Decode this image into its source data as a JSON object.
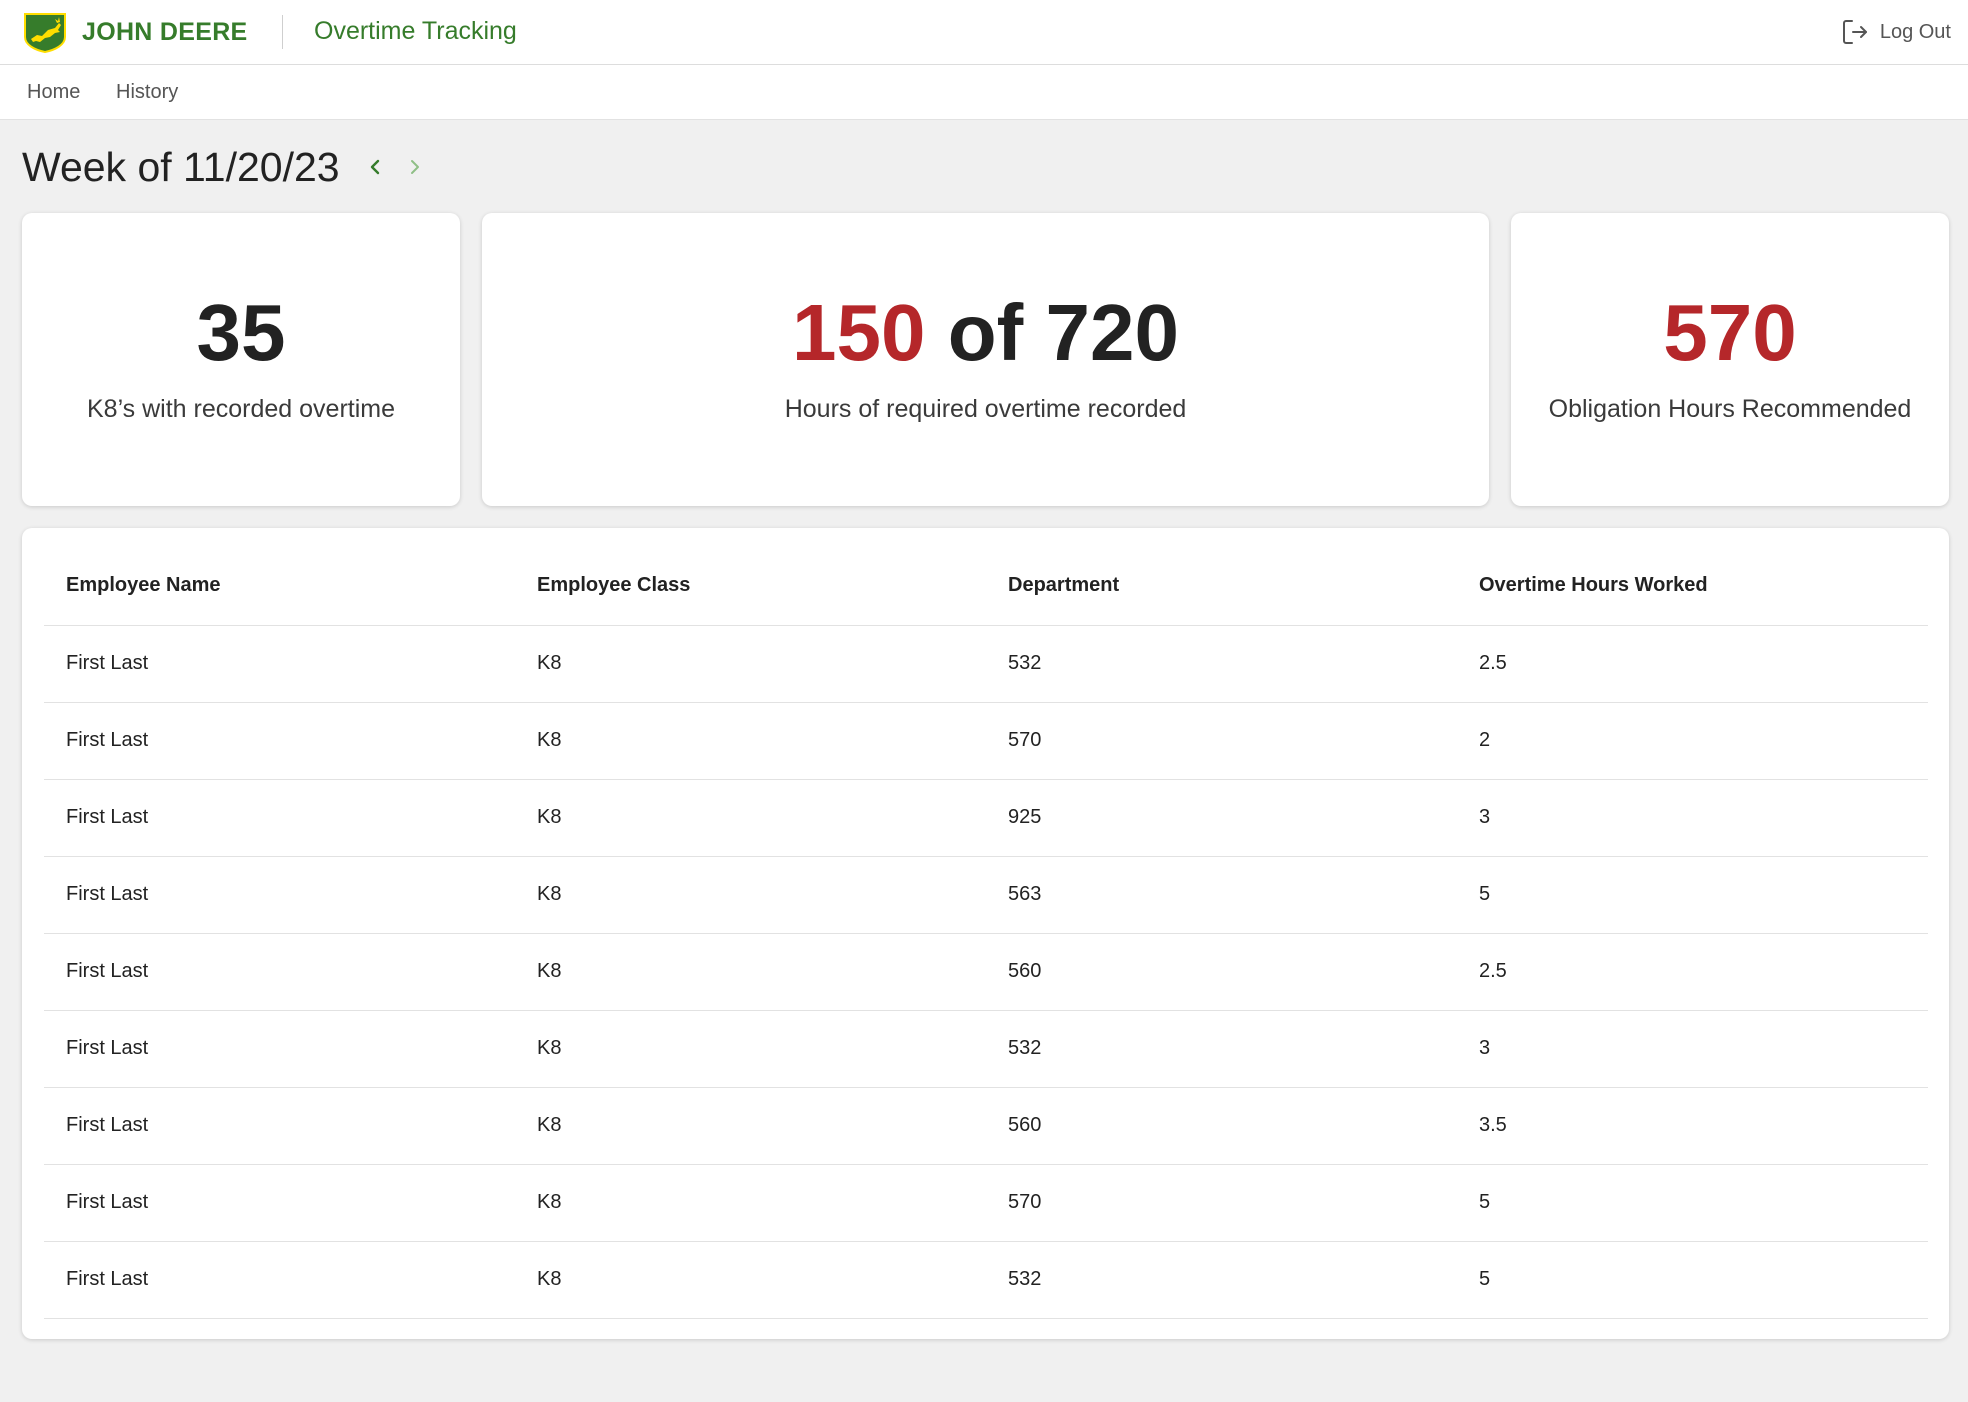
{
  "header": {
    "brand": "JOHN DEERE",
    "app_title": "Overtime Tracking",
    "logout_label": "Log Out"
  },
  "nav": {
    "items": [
      {
        "label": "Home"
      },
      {
        "label": "History"
      }
    ]
  },
  "week": {
    "title": "Week of 11/20/23",
    "prev_icon": "chevron-left-icon",
    "next_icon": "chevron-right-icon"
  },
  "stats": {
    "k8_count": {
      "value": "35",
      "label": "K8’s with recorded overtime"
    },
    "required_hours": {
      "recorded": "150",
      "of_text": "of",
      "total": "720",
      "label": "Hours of required overtime recorded"
    },
    "obligation": {
      "value": "570",
      "label": "Obligation Hours Recommended"
    }
  },
  "table": {
    "headers": [
      "Employee Name",
      "Employee Class",
      "Department",
      "Overtime Hours Worked"
    ],
    "rows": [
      [
        "First Last",
        "K8",
        "532",
        "2.5"
      ],
      [
        "First Last",
        "K8",
        "570",
        "2"
      ],
      [
        "First Last",
        "K8",
        "925",
        "3"
      ],
      [
        "First Last",
        "K8",
        "563",
        "5"
      ],
      [
        "First Last",
        "K8",
        "560",
        "2.5"
      ],
      [
        "First Last",
        "K8",
        "532",
        "3"
      ],
      [
        "First Last",
        "K8",
        "560",
        "3.5"
      ],
      [
        "First Last",
        "K8",
        "570",
        "5"
      ],
      [
        "First Last",
        "K8",
        "532",
        "5"
      ]
    ]
  },
  "colors": {
    "brand_green": "#367c2b",
    "brand_yellow": "#ffde00",
    "accent_red": "#b5272a",
    "background": "#f0f0f0"
  }
}
